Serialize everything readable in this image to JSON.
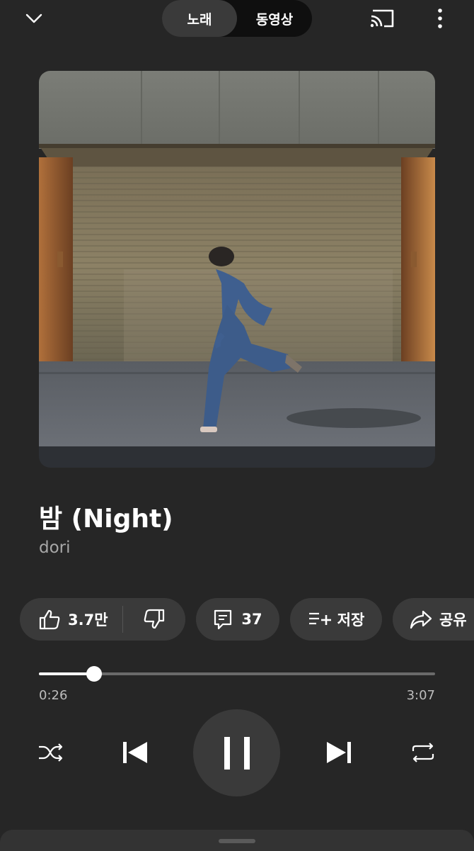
{
  "header": {
    "tabs": [
      {
        "label": "노래",
        "active": true
      },
      {
        "label": "동영상",
        "active": false
      }
    ],
    "icons": [
      "chevron-down-icon",
      "cast-icon",
      "more-vert-icon"
    ]
  },
  "song": {
    "title": "밤 (Night)",
    "artist": "dori"
  },
  "actions": {
    "like_count": "3.7만",
    "comment_count": "37",
    "save_label": "저장",
    "share_label": "공유"
  },
  "progress": {
    "current": "0:26",
    "total": "3:07",
    "fraction": 0.14
  },
  "colors": {
    "background": "#262626",
    "pill": "#3a3a3a",
    "toggle_bg": "#0f0f0f",
    "secondary_text": "#a8a8a8"
  }
}
